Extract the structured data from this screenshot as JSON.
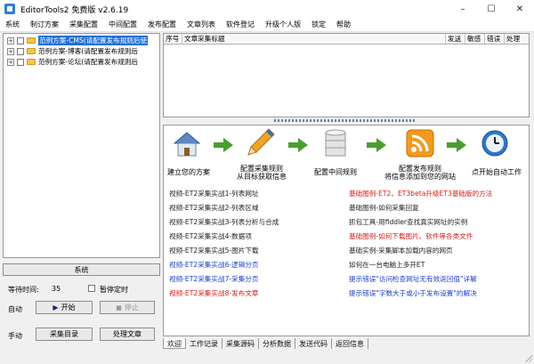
{
  "window": {
    "title": "EditorTools2 免费版 v2.6.19",
    "minimize": "–",
    "maximize": "☐",
    "close": "✕"
  },
  "menu": [
    "系统",
    "制订方案",
    "采集配置",
    "中间配置",
    "发布配置",
    "文章列表",
    "软件登记",
    "升级个人版",
    "锁定",
    "帮助"
  ],
  "tree": {
    "items": [
      {
        "label": "范例方案-CMS(请配置发布规则后使",
        "expander": "+",
        "selected": true
      },
      {
        "label": "范例方案-博客(请配置发布规则后",
        "expander": "+",
        "selected": false
      },
      {
        "label": "范例方案-论坛(请配置发布规则后",
        "expander": "+",
        "selected": false
      }
    ]
  },
  "controls": {
    "system_label": "系统",
    "wait_label": "等待时间:",
    "wait_value": "35",
    "pause_label": "暂停定时",
    "auto_label": "自动",
    "start_label": "开始",
    "stop_label": "停止",
    "manual_label": "手动",
    "collect_dir_label": "采集目录",
    "process_label": "处理文章"
  },
  "grid": {
    "columns": [
      "序号",
      "文章采集标题",
      "发送",
      "敏感",
      "错误",
      "处理"
    ]
  },
  "workflow": {
    "steps": [
      {
        "label_1": "建立您的方案",
        "label_2": ""
      },
      {
        "label_1": "配置采集规则",
        "label_2": "从目标获取信息"
      },
      {
        "label_1": "配置中间规则",
        "label_2": ""
      },
      {
        "label_1": "配置发布规则",
        "label_2": "将信息添加到您的网站"
      },
      {
        "label_1": "点开始自动工作",
        "label_2": ""
      }
    ],
    "icons": [
      "home-icon",
      "pencil-icon",
      "database-icon",
      "rss-icon",
      "clock-icon"
    ]
  },
  "links": {
    "left": [
      {
        "text": "视频-ET2采集实战1-列表网址",
        "color": "black"
      },
      {
        "text": "视频-ET2采集实战2-列表区域",
        "color": "black"
      },
      {
        "text": "视频-ET2采集实战3-列表分析与合成",
        "color": "black"
      },
      {
        "text": "视频-ET2采集实战4-数据项",
        "color": "black"
      },
      {
        "text": "视频-ET2采集实战5-图片下载",
        "color": "black"
      },
      {
        "text": "视频-ET2采集实战6-逻辑分页",
        "color": "blue"
      },
      {
        "text": "视频-ET2采集实战7-采集分页",
        "color": "blue"
      },
      {
        "text": "视频-ET2采集实战8-发布文章",
        "color": "red"
      }
    ],
    "right": [
      {
        "text": "基础图例-ET2、ET3beta升级ET3基础版的方法",
        "color": "red"
      },
      {
        "text": "基础图例-如何采集回复",
        "color": "black"
      },
      {
        "text": "抓包工具-用fiddler查找真实网址的实例",
        "color": "black"
      },
      {
        "text": "基础图例-如何下载图片、软件等各类文件",
        "color": "red"
      },
      {
        "text": "基础实例-采集脚本加载内容的网页",
        "color": "black"
      },
      {
        "text": "如何在一台电脑上多开ET",
        "color": "black"
      },
      {
        "text": "提示错误\"访问检查网址无有效返回值\"详解",
        "color": "blue"
      },
      {
        "text": "提示错误\"字数大于或小于发布设置\"的解决",
        "color": "blue"
      }
    ]
  },
  "tabs": [
    "欢迎",
    "工作记录",
    "采集源码",
    "分析数据",
    "发送代码",
    "返回信息"
  ],
  "colors": {
    "selection": "#1e6fd9",
    "arrow_green": "#4a9e2f",
    "link_blue": "#1b3fc9",
    "link_red": "#d61d1d"
  }
}
